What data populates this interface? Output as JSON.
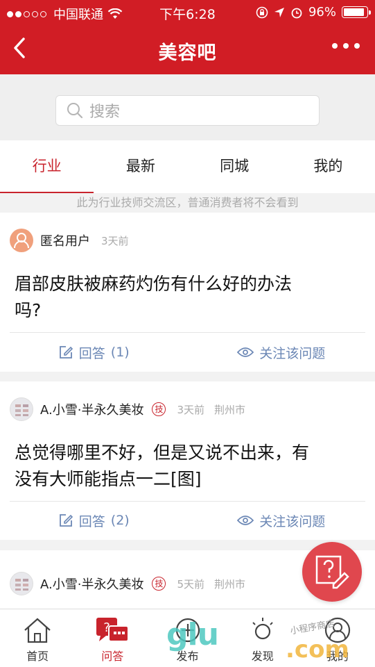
{
  "status": {
    "carrier": "中国联通",
    "time": "下午6:28",
    "battery": "96%",
    "battery_level": 0.96
  },
  "nav": {
    "title": "美容吧"
  },
  "search": {
    "placeholder": "搜索"
  },
  "tabs": [
    {
      "label": "行业",
      "active": true
    },
    {
      "label": "最新",
      "active": false
    },
    {
      "label": "同城",
      "active": false
    },
    {
      "label": "我的",
      "active": false
    }
  ],
  "notice": "此为行业技师交流区，普通消费者将不会看到",
  "posts": [
    {
      "user": "匿名用户",
      "time": "3天前",
      "badge": "",
      "location": "",
      "question_line1": "眉部皮肤被麻药灼伤有什么好的办法",
      "question_line2": "吗?",
      "answer_label": "回答",
      "answer_count": "(1)",
      "follow_label": "关注该问题"
    },
    {
      "user": "A.小雪·半永久美妆",
      "badge": "技",
      "time": "3天前",
      "location": "荆州市",
      "question_line1": "总觉得哪里不好，但是又说不出来，有",
      "question_line2": "没有大师能指点一二[图]",
      "answer_label": "回答",
      "answer_count": "(2)",
      "follow_label": "关注该问题"
    },
    {
      "user": "A.小雪·半永久美妆",
      "badge": "技",
      "time": "5天前",
      "location": "荆州市"
    }
  ],
  "bottom_nav": [
    {
      "label": "首页",
      "icon": "home-icon",
      "active": false
    },
    {
      "label": "问答",
      "icon": "qa-icon",
      "active": true
    },
    {
      "label": "发布",
      "icon": "publish-icon",
      "active": false
    },
    {
      "label": "发现",
      "icon": "discover-icon",
      "active": false
    },
    {
      "label": "我的",
      "icon": "profile-icon",
      "active": false
    }
  ],
  "watermark": {
    "main": "glu",
    "suffix": ".com",
    "small": "小程序商店"
  },
  "colors": {
    "brand_red": "#d11d25",
    "link_blue": "#6b87b5"
  }
}
